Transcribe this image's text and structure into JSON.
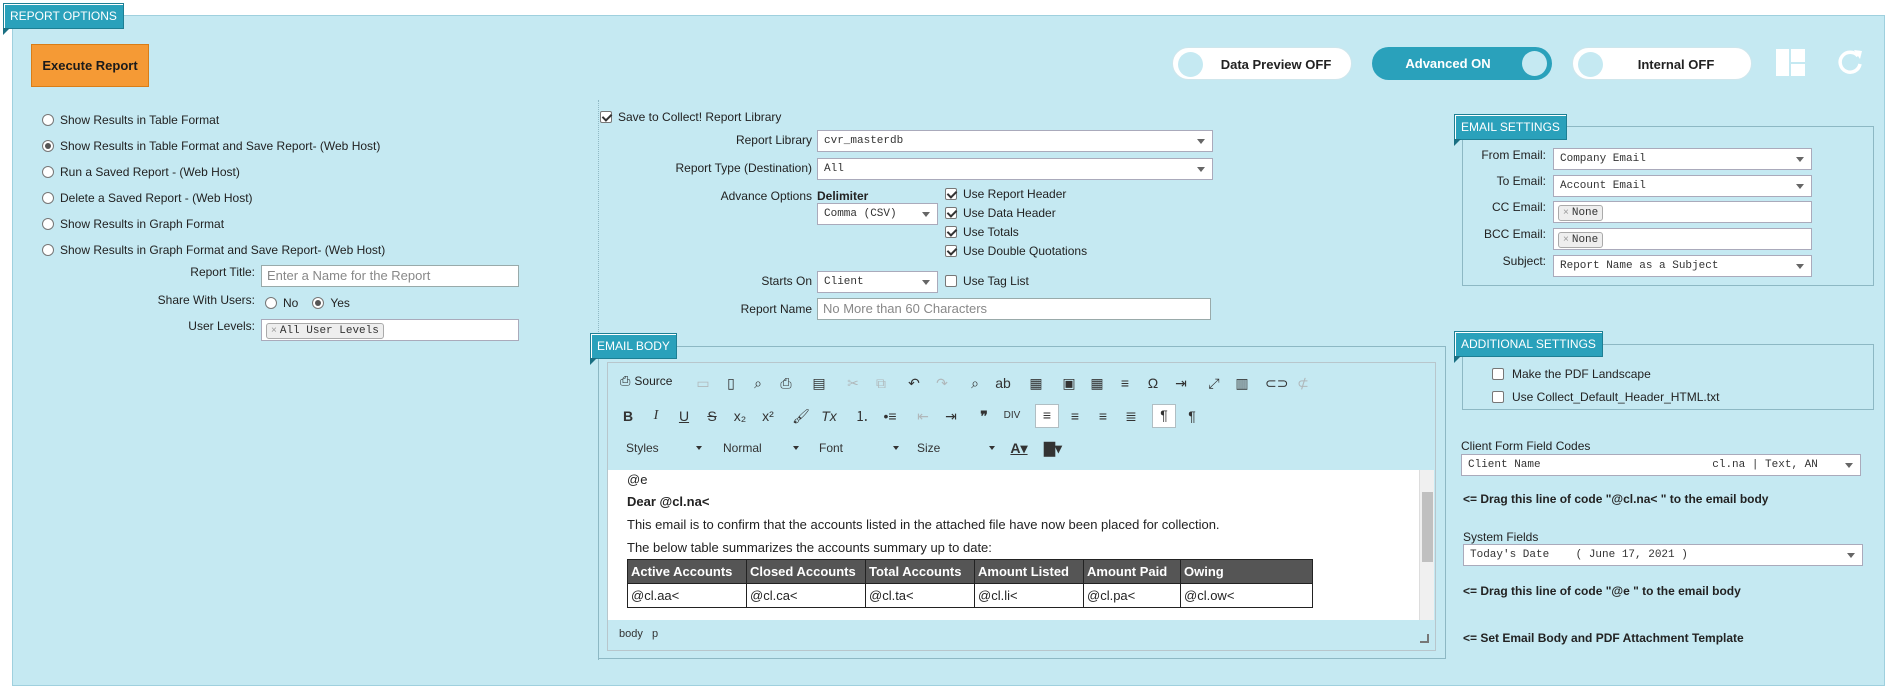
{
  "header_tab": "REPORT OPTIONS",
  "execute_button": "Execute Report",
  "toggles": {
    "data_preview": "Data Preview OFF",
    "advanced": "Advanced ON",
    "internal": "Internal OFF"
  },
  "report_modes": [
    {
      "label": "Show Results in Table Format",
      "checked": false
    },
    {
      "label": "Show Results in Table Format and Save Report- (Web Host)",
      "checked": true
    },
    {
      "label": "Run a Saved Report - (Web Host)",
      "checked": false
    },
    {
      "label": "Delete a Saved Report - (Web Host)",
      "checked": false
    },
    {
      "label": "Show Results in Graph Format",
      "checked": false
    },
    {
      "label": "Show Results in Graph Format and Save Report- (Web Host)",
      "checked": false
    }
  ],
  "report_title": {
    "label": "Report Title:",
    "placeholder": "Enter a Name for the Report"
  },
  "share": {
    "label": "Share With Users:",
    "no": "No",
    "yes": "Yes",
    "selected": "Yes"
  },
  "user_levels": {
    "label": "User Levels:",
    "tag": "All User Levels"
  },
  "save_library": {
    "label": "Save to Collect! Report Library",
    "checked": true
  },
  "report_library": {
    "label": "Report Library",
    "value": "cvr_masterdb"
  },
  "report_type": {
    "label": "Report Type (Destination)",
    "value": "All"
  },
  "advance_options": {
    "label": "Advance Options",
    "delimiter_label": "Delimiter",
    "delimiter_value": "Comma (CSV)",
    "checks": [
      {
        "label": "Use Report Header",
        "checked": true
      },
      {
        "label": "Use Data Header",
        "checked": true
      },
      {
        "label": "Use Totals",
        "checked": true
      },
      {
        "label": "Use Double Quotations",
        "checked": true
      }
    ]
  },
  "starts_on": {
    "label": "Starts On",
    "value": "Client",
    "tag_list": "Use Tag List"
  },
  "report_name": {
    "label": "Report Name",
    "placeholder": "No More than 60 Characters"
  },
  "email_settings": {
    "tab": "EMAIL SETTINGS",
    "from": {
      "label": "From Email:",
      "value": "Company Email"
    },
    "to": {
      "label": "To Email:",
      "value": "Account Email"
    },
    "cc": {
      "label": "CC Email:",
      "tag": "None"
    },
    "bcc": {
      "label": "BCC Email:",
      "tag": "None"
    },
    "subject": {
      "label": "Subject:",
      "value": "Report Name as a Subject"
    }
  },
  "email_body": {
    "tab": "EMAIL BODY",
    "toolbar": {
      "source": "Source",
      "styles": "Styles",
      "format": "Normal",
      "font": "Font",
      "size": "Size"
    },
    "content": {
      "line0": "@e",
      "greeting": "Dear @cl.na<",
      "para1": "This email is to confirm that the accounts listed in the attached file have now been placed for collection.",
      "para2": "The below table summarizes the accounts summary up to date:",
      "columns": [
        "Active Accounts",
        "Closed Accounts",
        "Total Accounts",
        "Amount Listed",
        "Amount Paid",
        "Owing"
      ],
      "row": [
        "@cl.aa<",
        "@cl.ca<",
        "@cl.ta<",
        "@cl.li<",
        "@cl.pa<",
        "@cl.ow<"
      ]
    },
    "path": [
      "body",
      "p"
    ]
  },
  "additional_settings": {
    "tab": "ADDITIONAL SETTINGS",
    "landscape": "Make the PDF Landscape",
    "header_html": "Use Collect_Default_Header_HTML.txt"
  },
  "client_codes": {
    "label": "Client Form Field Codes",
    "value": "Client Name                          cl.na | Text, AN",
    "hint": "<= Drag this line of code \"@cl.na< \" to the email body"
  },
  "system_fields": {
    "label": "System Fields",
    "value": "Today's Date    ( June 17, 2021 )",
    "hint": "<= Drag this line of code \"@e \" to the email body"
  },
  "template_hint": "<= Set Email Body and PDF Attachment Template",
  "icons": [
    "grid-icon",
    "refresh-icon"
  ]
}
